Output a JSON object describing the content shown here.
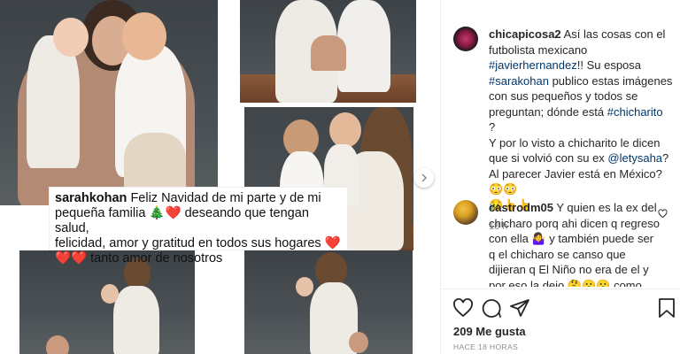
{
  "image": {
    "caption_user": "sarahkohan",
    "caption_line1": "Feliz Navidad de mi parte y de mi",
    "caption_line2": "pequeña familia",
    "caption_line3": "deseando que tengan salud,",
    "caption_line4": "felicidad, amor y gratitud en todos sus hogares",
    "caption_line5": "tanto amor de nosotros"
  },
  "post": {
    "author": "chicapicosa2",
    "text_1": "Así las cosas con el futbolista mexicano",
    "tag_1": "#javierhernandez",
    "text_2": "!! Su esposa",
    "tag_2": "#sarakohan",
    "text_3": "publico estas imágenes con sus pequeños y todos se preguntan; dónde está",
    "tag_3": "#chicharito",
    "text_4": "?",
    "text_5": "Y por lo visto a chicharito le dicen que si volvió con su ex",
    "tag_4": "@letysaha",
    "text_6": "? Al parecer Javier está en México? 😳😳",
    "text_7": "😥👆👆",
    "time": "18 h"
  },
  "comment": {
    "author": "castrodm05",
    "text": "Y quien es la ex del chicharo porq ahi dicen q regreso con ella 🤷‍♀️ y también puede ser q el chicharo se canso que dijieran q El Niño no era de el y por eso la dejo 🤔😮😮 como quiera q sea los niños son los"
  },
  "likes": "209 Me gusta",
  "time_ago": "HACE 18 HORAS",
  "icons": [
    "heart-icon",
    "comment-icon",
    "share-icon",
    "bookmark-icon",
    "chevron-right-icon",
    "small-heart-icon"
  ]
}
